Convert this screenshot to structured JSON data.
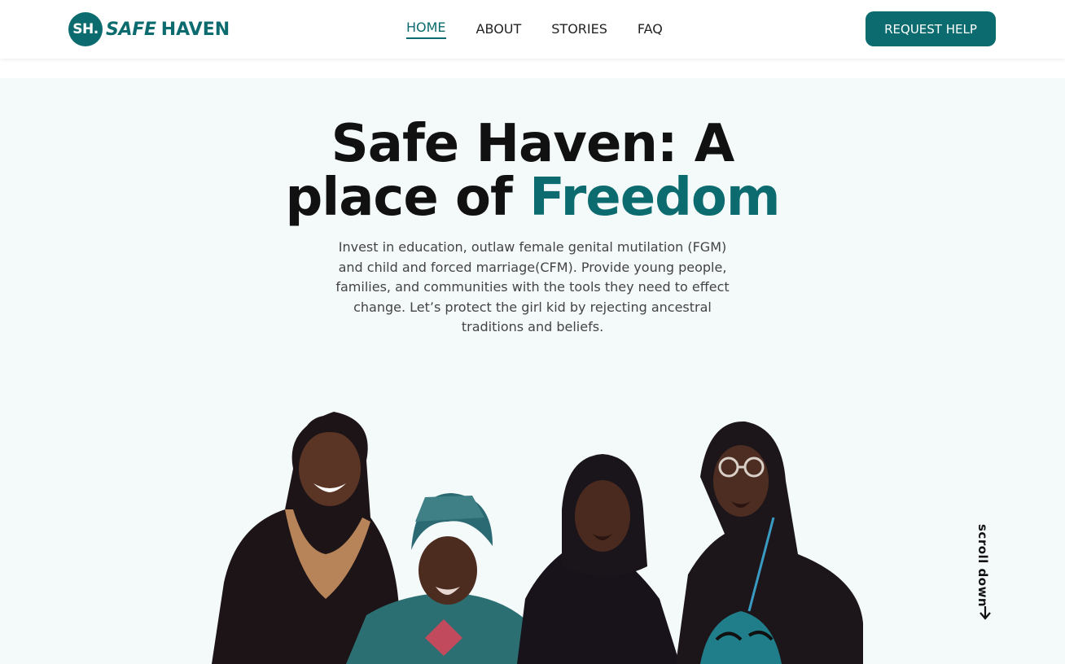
{
  "brand": {
    "badge": "SH.",
    "name_part1": "SAFE",
    "name_part2": "HAVEN",
    "color": "#0b6b6e"
  },
  "nav": {
    "items": [
      {
        "label": "HOME",
        "active": true
      },
      {
        "label": "ABOUT",
        "active": false
      },
      {
        "label": "STORIES",
        "active": false
      },
      {
        "label": "FAQ",
        "active": false
      }
    ]
  },
  "header": {
    "cta_label": "REQUEST HELP"
  },
  "hero": {
    "title_line1": "Safe Haven: A",
    "title_line2_prefix": "place of ",
    "title_line2_accent": "Freedom",
    "subtitle": "Invest in education, outlaw female genital mutilation (FGM) and child and forced marriage(CFM). Provide young people, families, and communities with the tools they need to effect change. Let’s protect the girl kid by rejecting ancestral traditions and beliefs.",
    "scroll_label": "scroll down",
    "background_color": "#f4f9f9"
  },
  "icons": {
    "scroll": "arrow-down-icon"
  }
}
